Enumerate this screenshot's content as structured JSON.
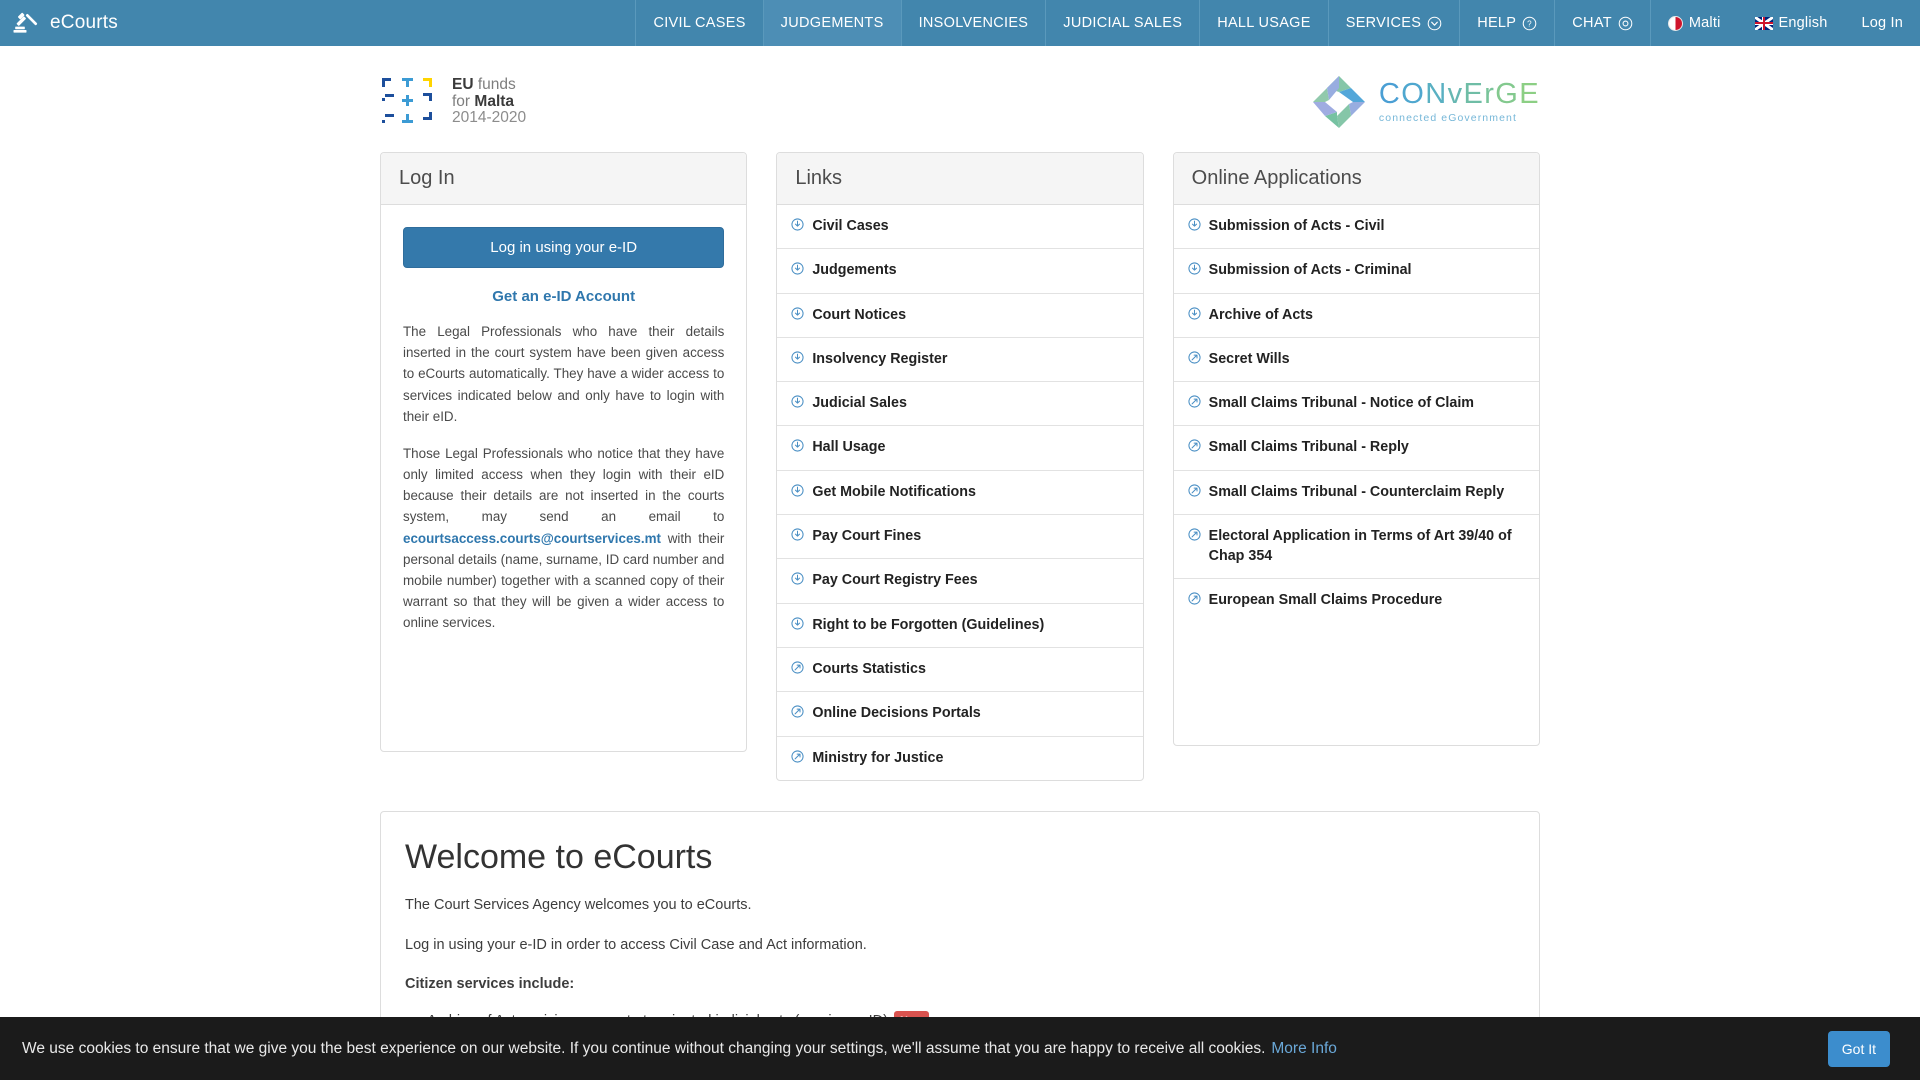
{
  "navbar": {
    "brand": "eCourts",
    "brand_icon": "gavel-icon",
    "items": [
      {
        "label": "CIVIL CASES",
        "icon": null,
        "active": false
      },
      {
        "label": "JUDGEMENTS",
        "icon": null,
        "active": true
      },
      {
        "label": "INSOLVENCIES",
        "icon": null,
        "active": false
      },
      {
        "label": "JUDICIAL SALES",
        "icon": null,
        "active": false
      },
      {
        "label": "HALL USAGE",
        "icon": null,
        "active": false
      },
      {
        "label": "SERVICES",
        "icon": "chevron-down-circle-icon",
        "active": false
      },
      {
        "label": "HELP",
        "icon": "question-circle-icon",
        "active": false
      },
      {
        "label": "CHAT",
        "icon": "chat-circle-icon",
        "active": false
      }
    ],
    "lang_mt": "Malti",
    "lang_en": "English",
    "login": "Log In",
    "bg_color": "#4286ad"
  },
  "logos": {
    "eu": {
      "line1_a": "EU ",
      "line1_b": "funds",
      "line2_a": "for ",
      "line2_b": "Malta",
      "line3": "2014-2020"
    },
    "converge": {
      "title": "CONvErGE",
      "subtitle": "connected eGovernment"
    }
  },
  "login_card": {
    "title": "Log In",
    "button": "Log in using your e-ID",
    "get_account_link": "Get an e-ID Account",
    "paragraph1": "The Legal Professionals who have their details inserted in the court system have been given access to eCourts automatically. They have a wider access to services indicated below and only have to login with their eID.",
    "paragraph2_before": "Those Legal Professionals who notice that they have only limited access when they login with their eID because their details are not inserted in the courts system, may send an email to ",
    "email": "ecourtsaccess.courts@courtservices.mt",
    "paragraph2_after": " with their personal details (name, surname, ID card number and mobile number) together with a scanned copy of their warrant so that they will be given a wider access to online services."
  },
  "links_card": {
    "title": "Links",
    "items": [
      {
        "label": "Civil Cases",
        "icon": "circle-down-arrow-icon"
      },
      {
        "label": "Judgements",
        "icon": "circle-down-arrow-icon"
      },
      {
        "label": "Court Notices",
        "icon": "circle-down-arrow-icon"
      },
      {
        "label": "Insolvency Register",
        "icon": "circle-down-arrow-icon"
      },
      {
        "label": "Judicial Sales",
        "icon": "circle-down-arrow-icon"
      },
      {
        "label": "Hall Usage",
        "icon": "circle-down-arrow-icon"
      },
      {
        "label": "Get Mobile Notifications",
        "icon": "circle-down-arrow-icon"
      },
      {
        "label": "Pay Court Fines",
        "icon": "circle-down-arrow-icon"
      },
      {
        "label": "Pay Court Registry Fees",
        "icon": "circle-down-arrow-icon"
      },
      {
        "label": "Right to be Forgotten (Guidelines)",
        "icon": "circle-down-arrow-icon"
      },
      {
        "label": "Courts Statistics",
        "icon": "circle-external-link-icon"
      },
      {
        "label": "Online Decisions Portals",
        "icon": "circle-external-link-icon"
      },
      {
        "label": "Ministry for Justice",
        "icon": "circle-external-link-icon"
      }
    ]
  },
  "apps_card": {
    "title": "Online Applications",
    "items": [
      {
        "label": "Submission of Acts - Civil",
        "icon": "circle-down-arrow-icon"
      },
      {
        "label": "Submission of Acts - Criminal",
        "icon": "circle-down-arrow-icon"
      },
      {
        "label": "Archive of Acts",
        "icon": "circle-down-arrow-icon"
      },
      {
        "label": "Secret Wills",
        "icon": "circle-external-link-icon"
      },
      {
        "label": "Small Claims Tribunal - Notice of Claim",
        "icon": "circle-external-link-icon"
      },
      {
        "label": "Small Claims Tribunal - Reply",
        "icon": "circle-external-link-icon"
      },
      {
        "label": "Small Claims Tribunal - Counterclaim Reply",
        "icon": "circle-external-link-icon"
      },
      {
        "label": "Electoral Application in Terms of Art 39/40 of Chap 354",
        "icon": "circle-external-link-icon"
      },
      {
        "label": "European Small Claims Procedure",
        "icon": "circle-external-link-icon"
      }
    ]
  },
  "welcome": {
    "heading": "Welcome to eCourts",
    "line1": "The Court Services Agency welcomes you to eCourts.",
    "line2": "Log in using your e-ID in order to access Civil Case and Act information.",
    "line3": "Citizen services include:",
    "bullets": [
      {
        "text": "Archive of Acts - giving access to terminated judicial acts (requires e-ID)",
        "badge": "New"
      }
    ]
  },
  "cookie": {
    "text": "We use cookies to ensure that we give you the best experience on our website. If you continue without changing your settings, we'll assume that you are happy to receive all cookies.",
    "more_info": "More Info",
    "button": "Got It"
  }
}
